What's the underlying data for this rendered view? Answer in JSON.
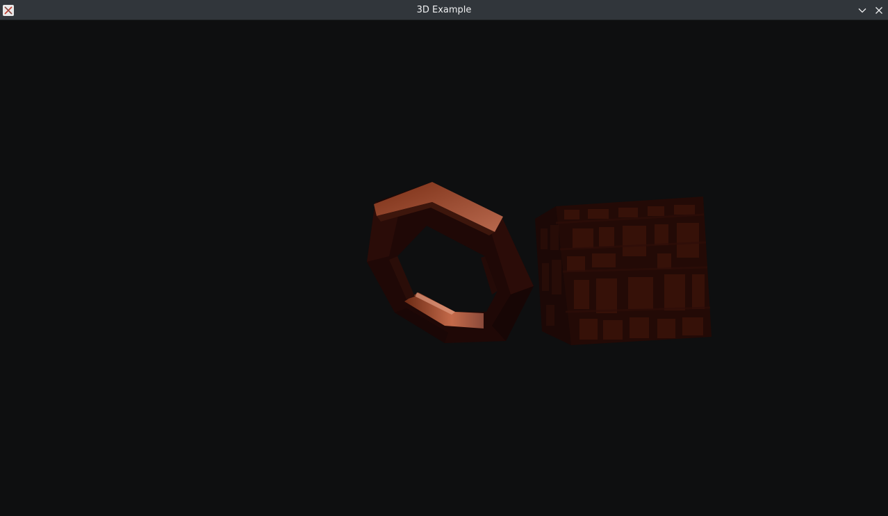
{
  "window": {
    "title": "3D Example",
    "app_icon": "application-icon",
    "buttons": {
      "minimize_icon": "chevron-down-icon",
      "close_icon": "close-icon"
    }
  },
  "scene": {
    "background_color": "#0e0f10",
    "objects": [
      {
        "name": "torus",
        "shape": "octagonal ring",
        "material_color": "#8a3a1c"
      },
      {
        "name": "cube",
        "shape": "textured box",
        "material_color": "#3a1108"
      }
    ]
  }
}
